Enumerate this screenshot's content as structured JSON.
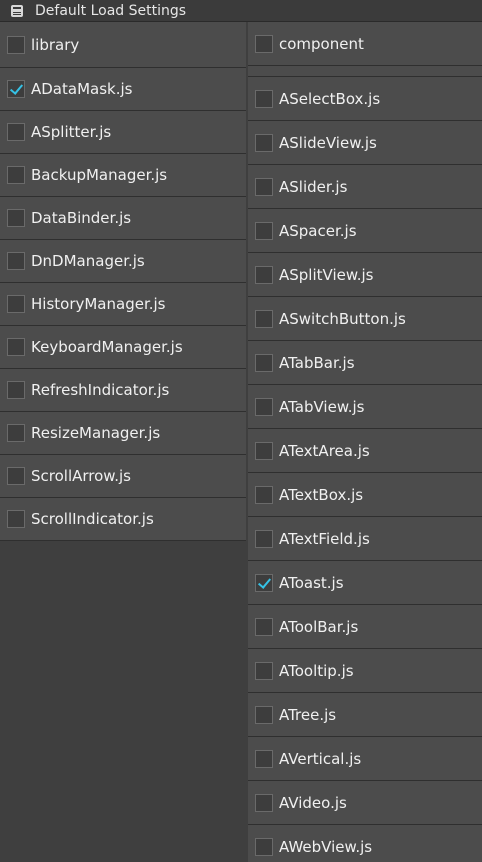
{
  "window": {
    "title": "Default Load Settings",
    "icon": "list-window-icon"
  },
  "colors": {
    "background": "#3f3f3f",
    "row": "#4c4c4c",
    "check": "#35c2e6",
    "text": "#f0f0f0"
  },
  "left_column": {
    "header": {
      "label": "library",
      "checked": false
    },
    "items": [
      {
        "label": "ADataMask.js",
        "checked": true
      },
      {
        "label": "ASplitter.js",
        "checked": false
      },
      {
        "label": "BackupManager.js",
        "checked": false
      },
      {
        "label": "DataBinder.js",
        "checked": false
      },
      {
        "label": "DnDManager.js",
        "checked": false
      },
      {
        "label": "HistoryManager.js",
        "checked": false
      },
      {
        "label": "KeyboardManager.js",
        "checked": false
      },
      {
        "label": "RefreshIndicator.js",
        "checked": false
      },
      {
        "label": "ResizeManager.js",
        "checked": false
      },
      {
        "label": "ScrollArrow.js",
        "checked": false
      },
      {
        "label": "ScrollIndicator.js",
        "checked": false
      }
    ]
  },
  "right_column": {
    "header": {
      "label": "component",
      "checked": false
    },
    "items": [
      {
        "label": "ASelectBox.js",
        "checked": false
      },
      {
        "label": "ASlideView.js",
        "checked": false
      },
      {
        "label": "ASlider.js",
        "checked": false
      },
      {
        "label": "ASpacer.js",
        "checked": false
      },
      {
        "label": "ASplitView.js",
        "checked": false
      },
      {
        "label": "ASwitchButton.js",
        "checked": false
      },
      {
        "label": "ATabBar.js",
        "checked": false
      },
      {
        "label": "ATabView.js",
        "checked": false
      },
      {
        "label": "ATextArea.js",
        "checked": false
      },
      {
        "label": "ATextBox.js",
        "checked": false
      },
      {
        "label": "ATextField.js",
        "checked": false
      },
      {
        "label": "AToast.js",
        "checked": true
      },
      {
        "label": "AToolBar.js",
        "checked": false
      },
      {
        "label": "ATooltip.js",
        "checked": false
      },
      {
        "label": "ATree.js",
        "checked": false
      },
      {
        "label": "AVertical.js",
        "checked": false
      },
      {
        "label": "AVideo.js",
        "checked": false
      },
      {
        "label": "AWebView.js",
        "checked": false
      }
    ]
  }
}
